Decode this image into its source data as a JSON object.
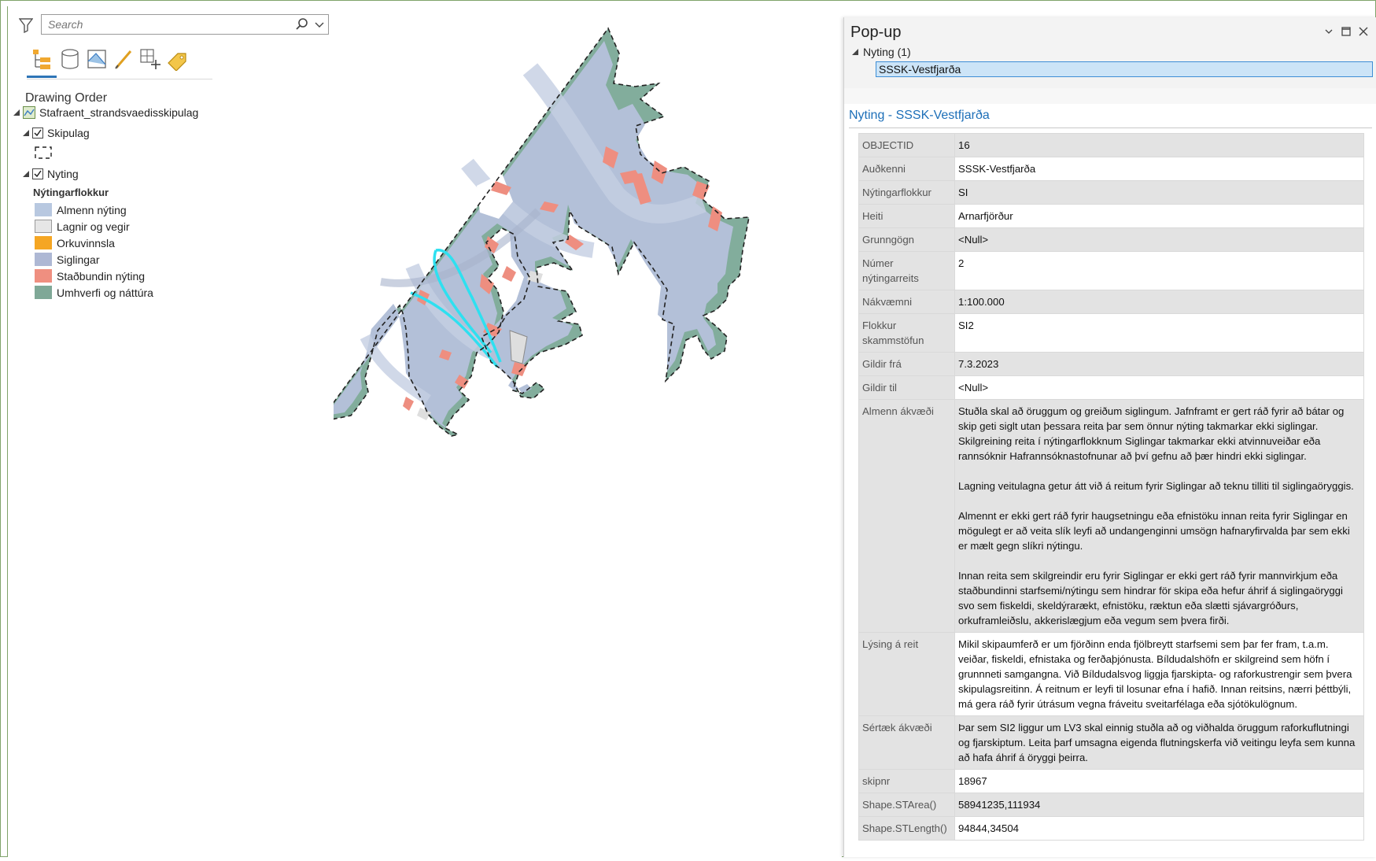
{
  "search": {
    "placeholder": "Search"
  },
  "toc": {
    "title": "Drawing Order",
    "root_layer": "Stafraent_strandsvaedisskipulag",
    "layers": [
      {
        "label": "Skipulag",
        "checked": true
      },
      {
        "label": "Nyting",
        "checked": true
      }
    ],
    "legend_heading": "Nýtingarflokkur",
    "legend": [
      {
        "label": "Almenn nýting",
        "color": "#b8c8e0"
      },
      {
        "label": "Lagnir og vegir",
        "color": "#e6e6e6"
      },
      {
        "label": "Orkuvinnsla",
        "color": "#f5a623"
      },
      {
        "label": "Siglingar",
        "color": "#aeb8d4"
      },
      {
        "label": "Staðbundin nýting",
        "color": "#ef8f80"
      },
      {
        "label": "Umhverfi og náttúra",
        "color": "#7fa897"
      }
    ]
  },
  "popup": {
    "title": "Pop-up",
    "tree_group": "Nyting (1)",
    "tree_item": "SSSK-Vestfjarða",
    "feature_title": "Nyting - SSSK-Vestfjarða",
    "attributes": {
      "objectid": {
        "key": "OBJECTID",
        "value": "16"
      },
      "audkenni": {
        "key": "Auðkenni",
        "value": "SSSK-Vestfjarða"
      },
      "flokkur": {
        "key": "Nýtingarflokkur",
        "value": "SI"
      },
      "heiti": {
        "key": "Heiti",
        "value": "Arnarfjörður"
      },
      "grunngogn": {
        "key": "Grunngögn",
        "value": "<Null>"
      },
      "numer": {
        "key": "Númer nýtingarreits",
        "value": "2"
      },
      "nakvaemni": {
        "key": "Nákvæmni",
        "value": "1:100.000"
      },
      "skammstofun": {
        "key": "Flokkur skammstöfun",
        "value": "SI2"
      },
      "gildir_fra": {
        "key": "Gildir frá",
        "value": "7.3.2023"
      },
      "gildir_til": {
        "key": "Gildir til",
        "value": "<Null>"
      },
      "almenn": {
        "key": "Almenn ákvæði",
        "p1": "Stuðla skal að öruggum og greiðum siglingum. Jafnframt er gert ráð fyrir að bátar og skip geti siglt utan þessara reita þar sem önnur nýting takmarkar ekki siglingar. Skilgreining reita í nýtingarflokknum Siglingar takmarkar ekki atvinnuveiðar eða rannsóknir Hafrannsóknastofnunar að því gefnu að þær hindri ekki siglingar.",
        "p2": "Lagning veitulagna getur átt við á reitum fyrir Siglingar að teknu tilliti til siglingaöryggis.",
        "p3": "Almennt er ekki gert ráð fyrir haugsetningu eða efnistöku innan reita fyrir Siglingar en mögulegt er að veita slík leyfi að undangenginni umsögn hafnaryfirvalda þar sem ekki er mælt gegn slíkri nýtingu.",
        "p4": "Innan reita sem skilgreindir eru fyrir Siglingar er ekki gert ráð fyrir mannvirkjum eða staðbundinni starfsemi/nýtingu sem hindrar för skipa eða hefur áhrif á siglingaöryggi svo sem fiskeldi, skeldýrarækt, efnistöku, ræktun eða slætti sjávargróðurs, orkuframleiðslu, akkerislægjum eða vegum sem þvera firði."
      },
      "lysing": {
        "key": "Lýsing á reit",
        "value": "Mikil skipaumferð er um fjörðinn enda fjölbreytt starfsemi sem þar fer fram, t.a.m. veiðar, fiskeldi, efnistaka og ferðaþjónusta. Bíldudalshöfn er skilgreind sem höfn í grunnneti samgangna. Við Bíldudalsvog liggja fjarskipta- og raforkustrengir sem þvera skipulagsreitinn. Á reitnum er leyfi til losunar efna í hafið. Innan reitsins, nærri þéttbýli, má gera ráð fyrir útrásum vegna fráveitu sveitarfélaga eða sjótökulögnum."
      },
      "sertaek": {
        "key": "Sértæk ákvæði",
        "value": "Þar sem SI2 liggur um LV3 skal einnig stuðla að og viðhalda öruggum raforkuflutningi og fjarskiptum. Leita þarf umsagna eigenda flutningskerfa við veitingu leyfa sem kunna að hafa áhrif á öryggi þeirra."
      },
      "skipnr": {
        "key": "skipnr",
        "value": "18967"
      },
      "starea": {
        "key": "Shape.STArea()",
        "value": "58941235,111934"
      },
      "stlength": {
        "key": "Shape.STLength()",
        "value": "94844,34504"
      }
    }
  }
}
